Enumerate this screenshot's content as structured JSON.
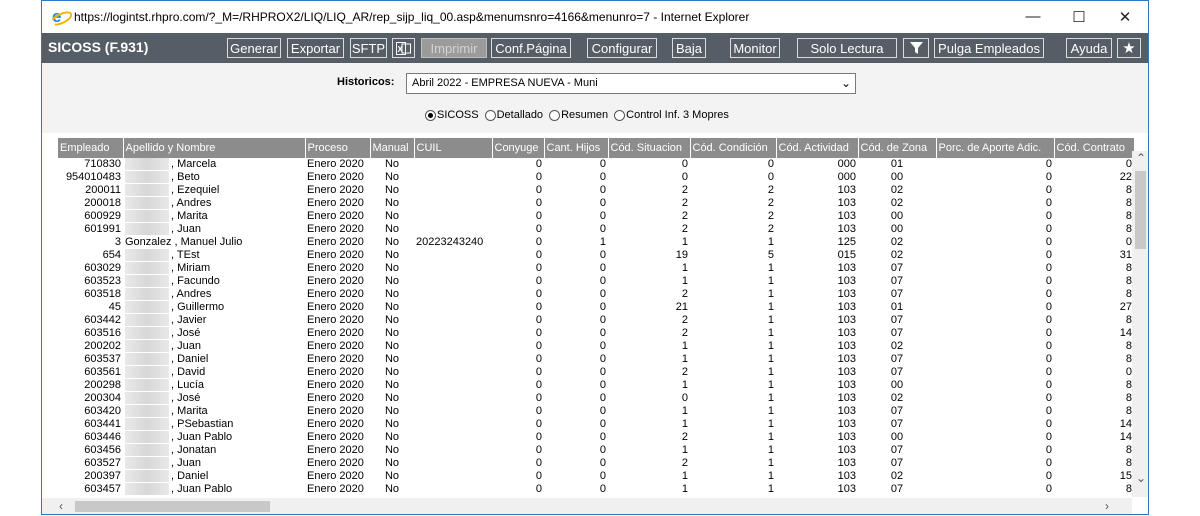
{
  "window": {
    "url_title": "https://logintst.rhpro.com/?_M=/RHPROX2/LIQ/LIQ_AR/rep_sijp_liq_00.asp&menumsnro=4166&menunro=7 - Internet Explorer",
    "minimize": "—",
    "maximize": "☐",
    "close": "✕"
  },
  "toolbar": {
    "title": "SICOSS (F.931)",
    "generar": "Generar",
    "exportar": "Exportar",
    "sftp": "SFTP",
    "imprimir": "Imprimir",
    "conf_pagina": "Conf.Página",
    "configurar": "Configurar",
    "baja": "Baja",
    "monitor": "Monitor",
    "solo_lectura": "Solo Lectura",
    "pulga": "Pulga Empleados",
    "ayuda": "Ayuda"
  },
  "filters": {
    "historicos_label": "Historicos:",
    "historicos_value": "Abril 2022 - EMPRESA NUEVA - Muni",
    "radios": [
      {
        "label": "SICOSS",
        "checked": true
      },
      {
        "label": "Detallado",
        "checked": false
      },
      {
        "label": "Resumen",
        "checked": false
      },
      {
        "label": "Control Inf. 3 Mopres",
        "checked": false
      }
    ]
  },
  "table": {
    "columns": [
      "Empleado",
      "Apellido y Nombre",
      "Proceso",
      "Manual",
      "CUIL",
      "Conyuge",
      "Cant. Hijos",
      "Cód. Situacion",
      "Cód. Condición",
      "Cód. Actividad",
      "Cód. de Zona",
      "Porc. de Aporte Adic.",
      "Cód. Contrato"
    ],
    "rows": [
      [
        "710830",
        ", Marcela",
        "Enero 2020",
        "No",
        "",
        "0",
        "0",
        "0",
        "0",
        "000",
        "01",
        "0",
        "0"
      ],
      [
        "954010483",
        ", Beto",
        "Enero 2020",
        "No",
        "",
        "0",
        "0",
        "0",
        "0",
        "000",
        "00",
        "0",
        "22"
      ],
      [
        "200011",
        ", Ezequiel",
        "Enero 2020",
        "No",
        "",
        "0",
        "0",
        "2",
        "2",
        "103",
        "02",
        "0",
        "8"
      ],
      [
        "200018",
        ", Andres",
        "Enero 2020",
        "No",
        "",
        "0",
        "0",
        "2",
        "2",
        "103",
        "02",
        "0",
        "8"
      ],
      [
        "600929",
        ", Marita",
        "Enero 2020",
        "No",
        "",
        "0",
        "0",
        "2",
        "2",
        "103",
        "00",
        "0",
        "8"
      ],
      [
        "601991",
        ", Juan",
        "Enero 2020",
        "No",
        "",
        "0",
        "0",
        "2",
        "2",
        "103",
        "00",
        "0",
        "8"
      ],
      [
        "3",
        "Gonzalez , Manuel Julio",
        "Enero 2020",
        "No",
        "20223243240",
        "0",
        "1",
        "1",
        "1",
        "125",
        "02",
        "0",
        "0"
      ],
      [
        "654",
        ", TEst",
        "Enero 2020",
        "No",
        "",
        "0",
        "0",
        "19",
        "5",
        "015",
        "02",
        "0",
        "31"
      ],
      [
        "603029",
        ", Miriam",
        "Enero 2020",
        "No",
        "",
        "0",
        "0",
        "1",
        "1",
        "103",
        "07",
        "0",
        "8"
      ],
      [
        "603523",
        ", Facundo",
        "Enero 2020",
        "No",
        "",
        "0",
        "0",
        "1",
        "1",
        "103",
        "07",
        "0",
        "8"
      ],
      [
        "603518",
        ", Andres",
        "Enero 2020",
        "No",
        "",
        "0",
        "0",
        "2",
        "1",
        "103",
        "07",
        "0",
        "8"
      ],
      [
        "45",
        ", Guillermo",
        "Enero 2020",
        "No",
        "",
        "0",
        "0",
        "21",
        "1",
        "103",
        "01",
        "0",
        "27"
      ],
      [
        "603442",
        ", Javier",
        "Enero 2020",
        "No",
        "",
        "0",
        "0",
        "2",
        "1",
        "103",
        "07",
        "0",
        "8"
      ],
      [
        "603516",
        ", José",
        "Enero 2020",
        "No",
        "",
        "0",
        "0",
        "2",
        "1",
        "103",
        "07",
        "0",
        "14"
      ],
      [
        "200202",
        ", Juan",
        "Enero 2020",
        "No",
        "",
        "0",
        "0",
        "1",
        "1",
        "103",
        "02",
        "0",
        "8"
      ],
      [
        "603537",
        ", Daniel",
        "Enero 2020",
        "No",
        "",
        "0",
        "0",
        "1",
        "1",
        "103",
        "07",
        "0",
        "8"
      ],
      [
        "603561",
        ", David",
        "Enero 2020",
        "No",
        "",
        "0",
        "0",
        "2",
        "1",
        "103",
        "07",
        "0",
        "0"
      ],
      [
        "200298",
        ", Lucía",
        "Enero 2020",
        "No",
        "",
        "0",
        "0",
        "1",
        "1",
        "103",
        "00",
        "0",
        "8"
      ],
      [
        "200304",
        ", José",
        "Enero 2020",
        "No",
        "",
        "0",
        "0",
        "0",
        "1",
        "103",
        "02",
        "0",
        "8"
      ],
      [
        "603420",
        ", Marita",
        "Enero 2020",
        "No",
        "",
        "0",
        "0",
        "1",
        "1",
        "103",
        "07",
        "0",
        "8"
      ],
      [
        "603441",
        ", PSebastian",
        "Enero 2020",
        "No",
        "",
        "0",
        "0",
        "1",
        "1",
        "103",
        "07",
        "0",
        "14"
      ],
      [
        "603446",
        ", Juan Pablo",
        "Enero 2020",
        "No",
        "",
        "0",
        "0",
        "2",
        "1",
        "103",
        "00",
        "0",
        "14"
      ],
      [
        "603456",
        ", Jonatan",
        "Enero 2020",
        "No",
        "",
        "0",
        "0",
        "1",
        "1",
        "103",
        "07",
        "0",
        "8"
      ],
      [
        "603527",
        ", Juan",
        "Enero 2020",
        "No",
        "",
        "0",
        "0",
        "2",
        "1",
        "103",
        "07",
        "0",
        "8"
      ],
      [
        "200397",
        ", Daniel",
        "Enero 2020",
        "No",
        "",
        "0",
        "0",
        "1",
        "1",
        "103",
        "02",
        "0",
        "15"
      ],
      [
        "603457",
        ", Juan Pablo",
        "Enero 2020",
        "No",
        "",
        "0",
        "0",
        "1",
        "1",
        "103",
        "07",
        "0",
        "8"
      ]
    ]
  }
}
